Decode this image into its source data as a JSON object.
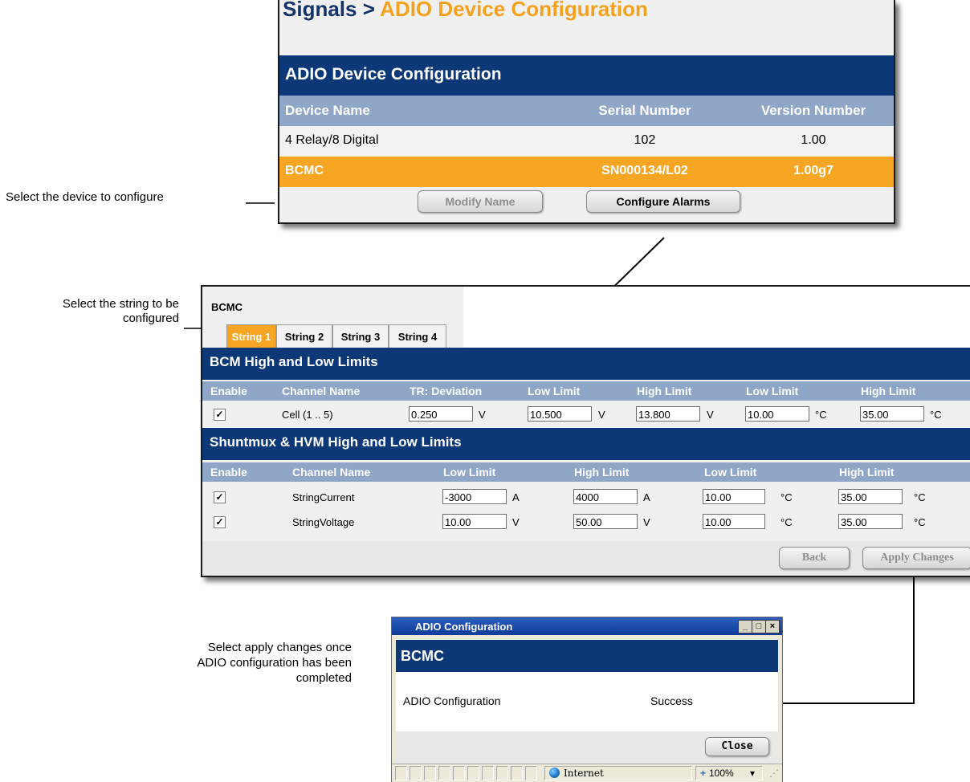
{
  "callouts": {
    "select_device": "Select the device to configure",
    "select_string": "Select the string to be configured",
    "apply_changes": "Select apply changes once ADIO configuration has been completed"
  },
  "panel1": {
    "breadcrumb_parent": "Signals >",
    "breadcrumb_current": "ADIO Device Configuration",
    "section_title": "ADIO Device Configuration",
    "columns": [
      "Device Name",
      "Serial Number",
      "Version Number"
    ],
    "rows": [
      {
        "name": "4 Relay/8 Digital",
        "serial": "102",
        "version": "1.00",
        "selected": false
      },
      {
        "name": "BCMC",
        "serial": "SN000134/L02",
        "version": "1.00g7",
        "selected": true
      }
    ],
    "buttons": {
      "modify_name": "Modify Name",
      "configure_alarms": "Configure Alarms"
    }
  },
  "panel2": {
    "device": "BCMC",
    "tabs": [
      "String 1",
      "String 2",
      "String 3",
      "String 4"
    ],
    "active_tab": "String 1",
    "bcm_section": {
      "title": "BCM High and Low Limits",
      "columns": [
        "Enable",
        "Channel Name",
        "TR: Deviation",
        "Low Limit",
        "High Limit",
        "Low Limit",
        "High Limit"
      ],
      "rows": [
        {
          "enabled": true,
          "channel": "Cell (1 .. 5)",
          "deviation": "0.250",
          "deviation_unit": "V",
          "low_v": "10.500",
          "low_v_unit": "V",
          "high_v": "13.800",
          "high_v_unit": "V",
          "low_t": "10.00",
          "low_t_unit": "°C",
          "high_t": "35.00",
          "high_t_unit": "°C"
        }
      ]
    },
    "shunt_section": {
      "title": "Shuntmux & HVM High and Low Limits",
      "columns": [
        "Enable",
        "Channel Name",
        "Low Limit",
        "High Limit",
        "Low Limit",
        "High Limit"
      ],
      "rows": [
        {
          "enabled": true,
          "channel": "StringCurrent",
          "low": "-3000",
          "low_unit": "A",
          "high": "4000",
          "high_unit": "A",
          "low_t": "10.00",
          "low_t_unit": "°C",
          "high_t": "35.00",
          "high_t_unit": "°C"
        },
        {
          "enabled": true,
          "channel": "StringVoltage",
          "low": "10.00",
          "low_unit": "V",
          "high": "50.00",
          "high_unit": "V",
          "low_t": "10.00",
          "low_t_unit": "°C",
          "high_t": "35.00",
          "high_t_unit": "°C"
        }
      ]
    },
    "buttons": {
      "back": "Back",
      "apply": "Apply Changes"
    }
  },
  "dialog": {
    "title": "ADIO Configuration",
    "window_buttons": [
      "_",
      "□",
      "×"
    ],
    "device": "BCMC",
    "result_label": "ADIO Configuration",
    "result_value": "Success",
    "close": "Close",
    "status_zone": "Internet",
    "zoom": "100%",
    "zoom_icon": "+",
    "zoom_dropdown": "▾"
  },
  "colors": {
    "navy": "#0c3877",
    "header_blue": "#8fa6c7",
    "accent_orange": "#f7a623"
  }
}
